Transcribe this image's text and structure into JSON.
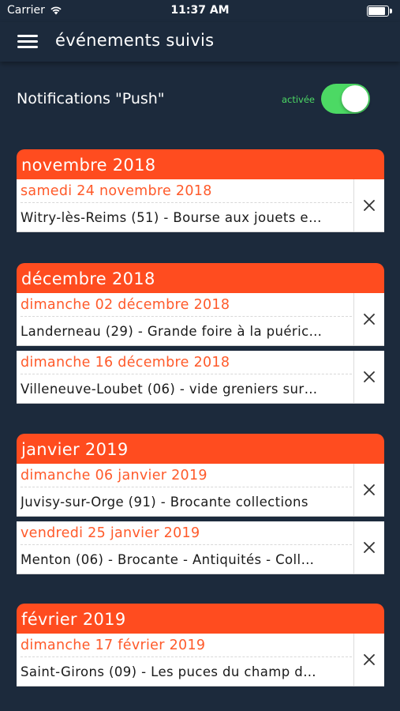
{
  "status_bar": {
    "carrier": "Carrier",
    "time": "11:37 AM"
  },
  "header": {
    "title": "événements suivis"
  },
  "push": {
    "label": "Notifications \"Push\"",
    "state_label": "activée",
    "enabled": true
  },
  "months": [
    {
      "label": "novembre 2018",
      "events": [
        {
          "date": "samedi 24 novembre 2018",
          "title": "Witry-lès-Reims (51) - Bourse aux jouets e…"
        }
      ]
    },
    {
      "label": "décembre 2018",
      "events": [
        {
          "date": "dimanche 02 décembre 2018",
          "title": "Landerneau (29) - Grande foire à la puéric…"
        },
        {
          "date": "dimanche 16 décembre 2018",
          "title": "Villeneuve-Loubet (06) - vide greniers sur…"
        }
      ]
    },
    {
      "label": "janvier 2019",
      "events": [
        {
          "date": "dimanche 06 janvier 2019",
          "title": "Juvisy-sur-Orge (91) - Brocante collections"
        },
        {
          "date": "vendredi 25 janvier 2019",
          "title": "Menton (06) - Brocante - Antiquités - Coll…"
        }
      ]
    },
    {
      "label": "février 2019",
      "events": [
        {
          "date": "dimanche 17 février 2019",
          "title": "Saint-Girons (09) - Les puces du champ d…"
        }
      ]
    }
  ],
  "colors": {
    "background": "#1c2a3c",
    "accent": "#ff4c1f",
    "date_text": "#ff5a2a",
    "toggle_on": "#4cd964"
  }
}
